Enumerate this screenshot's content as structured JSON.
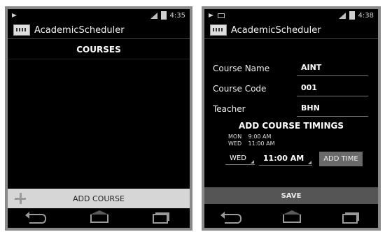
{
  "left_screen": {
    "status": {
      "time": "4:35"
    },
    "app_title": "AcademicScheduler",
    "section_title": "COURSES",
    "add_course_label": "ADD COURSE"
  },
  "right_screen": {
    "status": {
      "time": "4:38"
    },
    "app_title": "AcademicScheduler",
    "form": {
      "course_name_label": "Course Name",
      "course_name_value": "AINT",
      "course_code_label": "Course Code",
      "course_code_value": "001",
      "teacher_label": "Teacher",
      "teacher_value": "BHN"
    },
    "timings_title": "ADD COURSE TIMINGS",
    "timings": [
      {
        "day": "MON",
        "time": "9:00 AM"
      },
      {
        "day": "WED",
        "time": "11:00 AM"
      }
    ],
    "day_spinner_value": "WED",
    "time_spinner_value": "11:00 AM",
    "add_time_label": "ADD TIME",
    "save_label": "SAVE"
  }
}
